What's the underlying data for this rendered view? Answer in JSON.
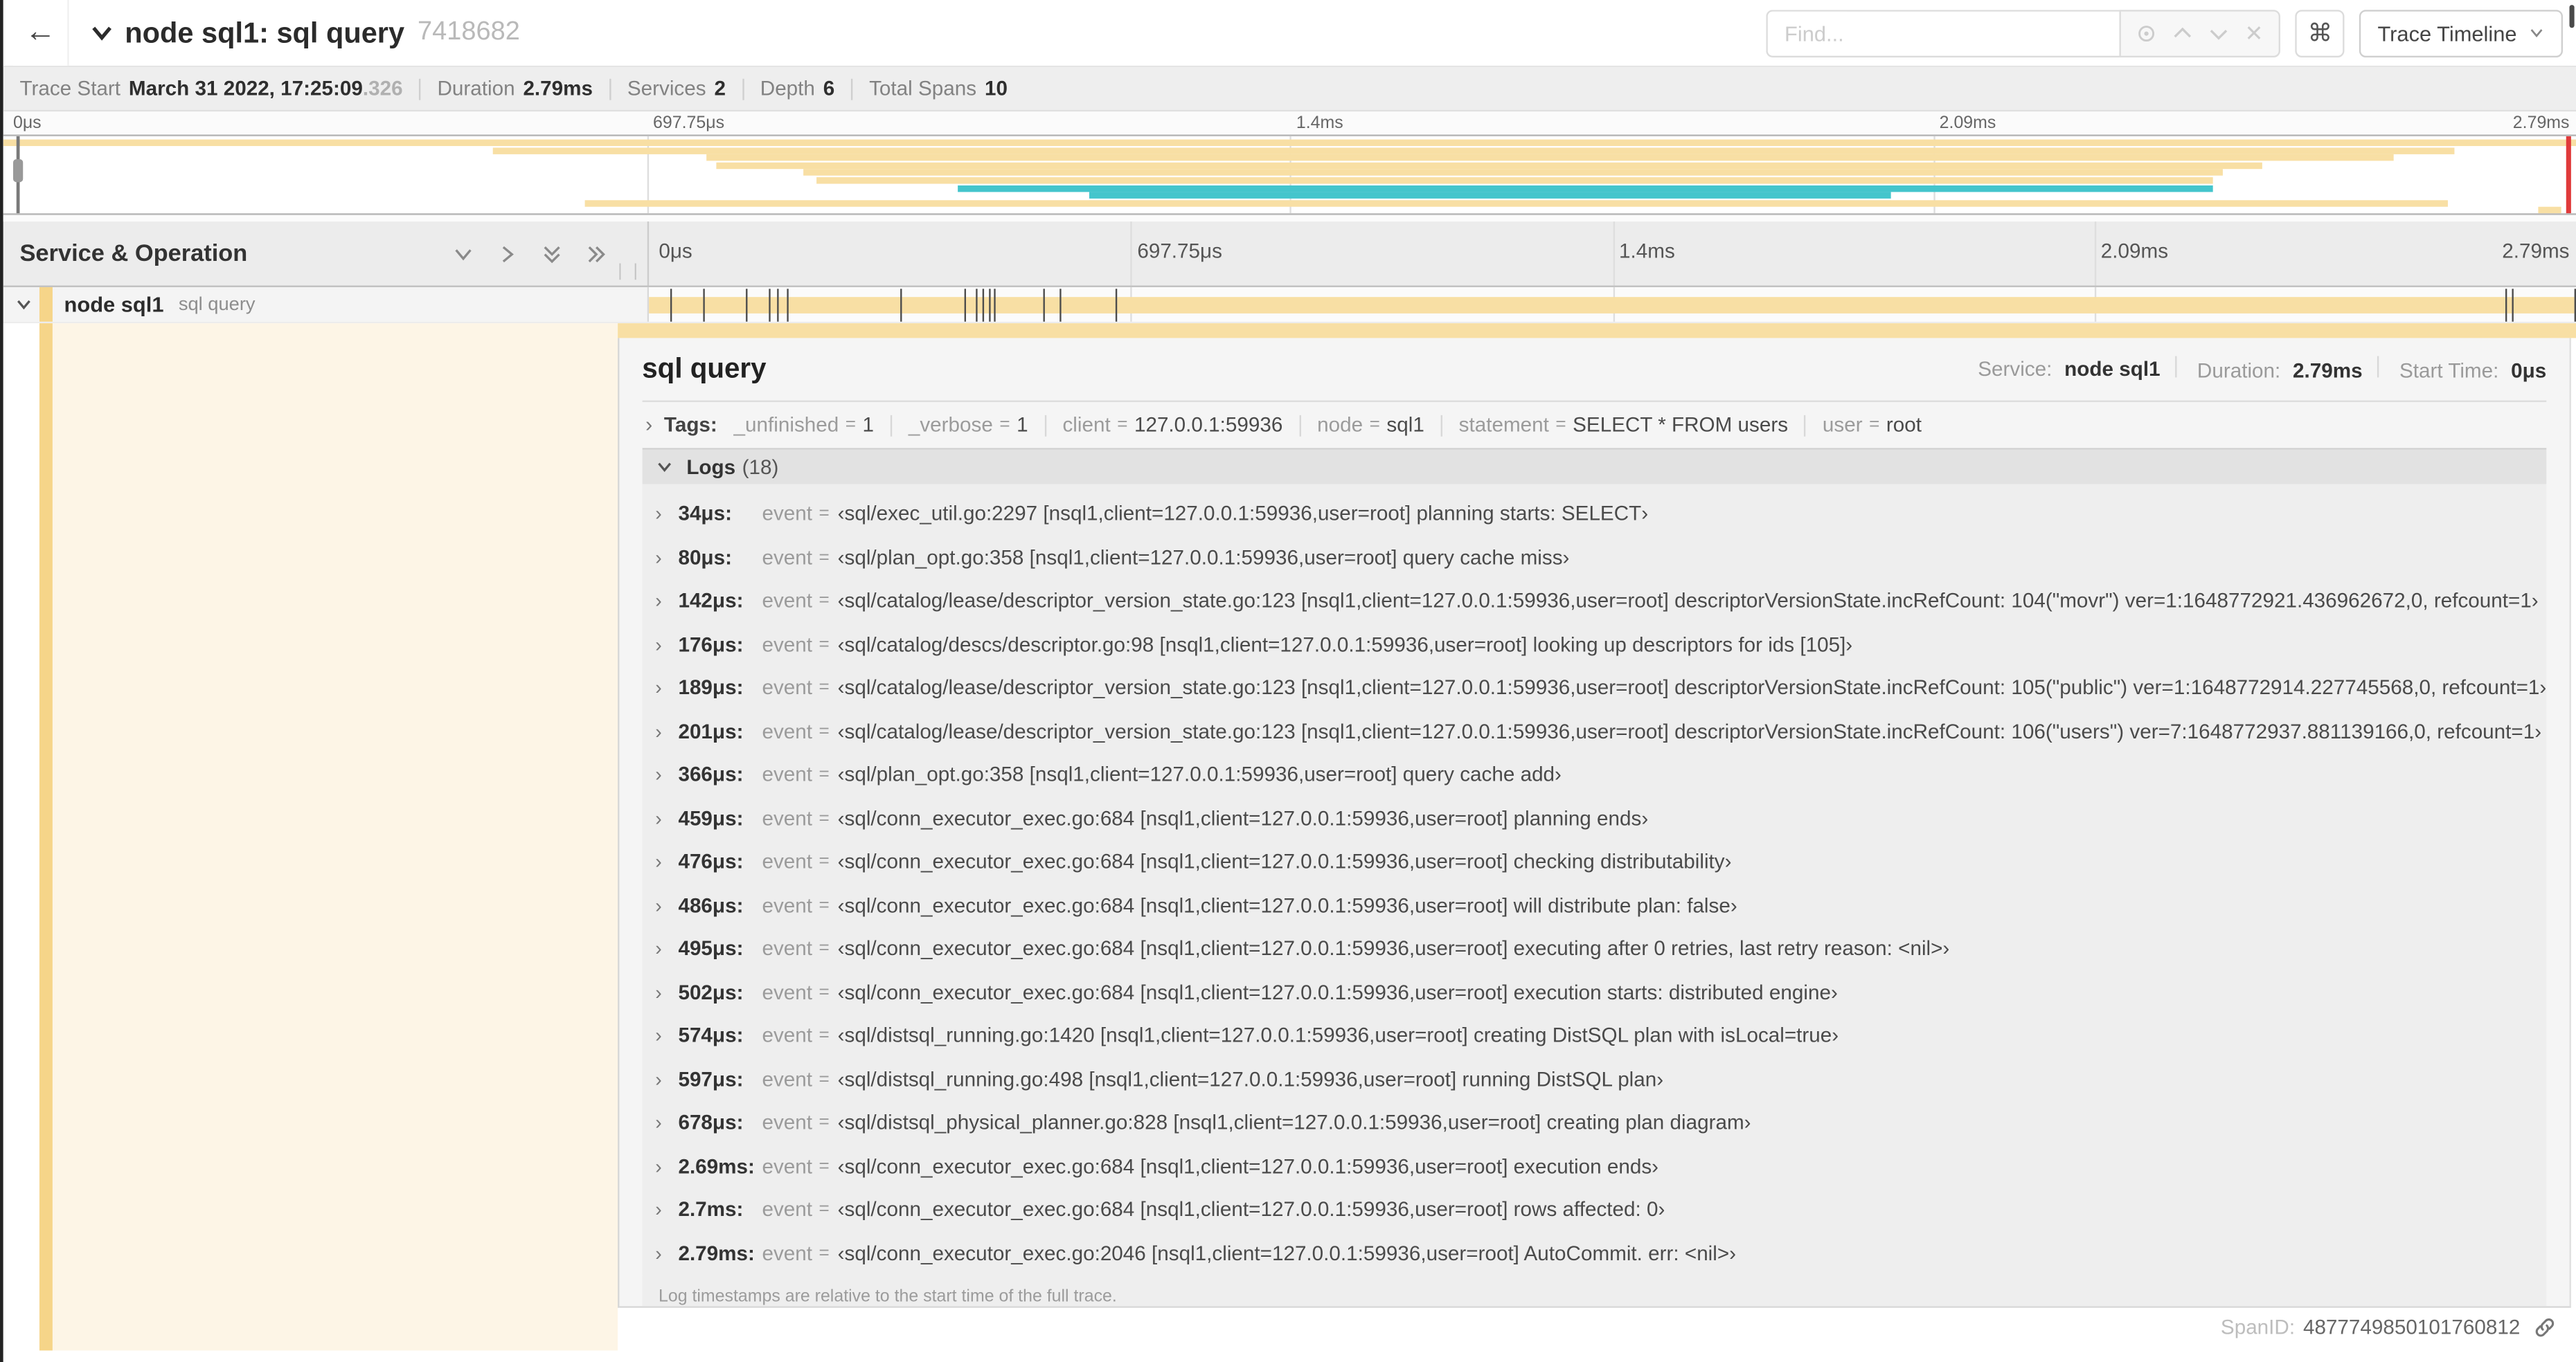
{
  "colors": {
    "tan": "#f8dfa4",
    "teal": "#44c5cc",
    "indent": "#f6d589",
    "cream": "#fdf5e6"
  },
  "trace": {
    "duration_us": 2790
  },
  "header": {
    "back_icon": "←",
    "title": "node sql1: sql query",
    "trace_id": "7418682",
    "find_placeholder": "Find...",
    "shortcut_label": "⌘",
    "view_selector_label": "Trace Timeline"
  },
  "summary": {
    "items": [
      {
        "label": "Trace Start",
        "value": "March 31 2022, 17:25:09",
        "suffix": ".326"
      },
      {
        "label": "Duration",
        "value": "2.79ms",
        "suffix": ""
      },
      {
        "label": "Services",
        "value": "2",
        "suffix": ""
      },
      {
        "label": "Depth",
        "value": "6",
        "suffix": ""
      },
      {
        "label": "Total Spans",
        "value": "10",
        "suffix": ""
      }
    ]
  },
  "timeline": {
    "ticks": [
      {
        "label": "0μs",
        "pct": 0
      },
      {
        "label": "697.75μs",
        "pct": 25
      },
      {
        "label": "1.4ms",
        "pct": 50
      },
      {
        "label": "2.09ms",
        "pct": 75
      },
      {
        "label": "2.79ms",
        "pct": 100
      }
    ]
  },
  "minimap": {
    "spans": [
      {
        "start": 0,
        "end": 100,
        "color": "tan"
      },
      {
        "start": 19,
        "end": 95.3,
        "color": "tan"
      },
      {
        "start": 27.3,
        "end": 92.9,
        "color": "tan"
      },
      {
        "start": 27.7,
        "end": 87.8,
        "color": "tan"
      },
      {
        "start": 31.1,
        "end": 86.3,
        "color": "tan"
      },
      {
        "start": 31.6,
        "end": 85.9,
        "color": "tan"
      },
      {
        "start": 37.1,
        "end": 85.9,
        "color": "teal"
      },
      {
        "start": 42.2,
        "end": 73.4,
        "color": "teal"
      },
      {
        "start": 22.6,
        "end": 95.0,
        "color": "tan"
      },
      {
        "start": 98.5,
        "end": 99.4,
        "color": "tan"
      }
    ]
  },
  "span_list": {
    "header": "Service & Operation",
    "row": {
      "service": "node sql1",
      "operation": "sql query"
    }
  },
  "detail": {
    "title": "sql query",
    "meta": [
      {
        "label": "Service:",
        "value": "node sql1"
      },
      {
        "label": "Duration:",
        "value": "2.79ms"
      },
      {
        "label": "Start Time:",
        "value": "0μs"
      }
    ],
    "tags_label": "Tags:",
    "tags": [
      {
        "key": "_unfinished",
        "value": "1"
      },
      {
        "key": "_verbose",
        "value": "1"
      },
      {
        "key": "client",
        "value": "127.0.0.1:59936"
      },
      {
        "key": "node",
        "value": "sql1"
      },
      {
        "key": "statement",
        "value": "SELECT * FROM users"
      },
      {
        "key": "user",
        "value": "root"
      }
    ],
    "logs_label": "Logs",
    "logs_count": "(18)",
    "event_key": "event",
    "logs": [
      {
        "time": "34μs:",
        "time_us": 34,
        "value": "‹sql/exec_util.go:2297 [nsql1,client=127.0.0.1:59936,user=root] planning starts: SELECT›"
      },
      {
        "time": "80μs:",
        "time_us": 80,
        "value": "‹sql/plan_opt.go:358 [nsql1,client=127.0.0.1:59936,user=root] query cache miss›"
      },
      {
        "time": "142μs:",
        "time_us": 142,
        "value": "‹sql/catalog/lease/descriptor_version_state.go:123 [nsql1,client=127.0.0.1:59936,user=root] descriptorVersionState.incRefCount: 104(\"movr\") ver=1:1648772921.436962672,0, refcount=1›"
      },
      {
        "time": "176μs:",
        "time_us": 176,
        "value": "‹sql/catalog/descs/descriptor.go:98 [nsql1,client=127.0.0.1:59936,user=root] looking up descriptors for ids [105]›"
      },
      {
        "time": "189μs:",
        "time_us": 189,
        "value": "‹sql/catalog/lease/descriptor_version_state.go:123 [nsql1,client=127.0.0.1:59936,user=root] descriptorVersionState.incRefCount: 105(\"public\") ver=1:1648772914.227745568,0, refcount=1›"
      },
      {
        "time": "201μs:",
        "time_us": 201,
        "value": "‹sql/catalog/lease/descriptor_version_state.go:123 [nsql1,client=127.0.0.1:59936,user=root] descriptorVersionState.incRefCount: 106(\"users\") ver=7:1648772937.881139166,0, refcount=1›"
      },
      {
        "time": "366μs:",
        "time_us": 366,
        "value": "‹sql/plan_opt.go:358 [nsql1,client=127.0.0.1:59936,user=root] query cache add›"
      },
      {
        "time": "459μs:",
        "time_us": 459,
        "value": "‹sql/conn_executor_exec.go:684 [nsql1,client=127.0.0.1:59936,user=root] planning ends›"
      },
      {
        "time": "476μs:",
        "time_us": 476,
        "value": "‹sql/conn_executor_exec.go:684 [nsql1,client=127.0.0.1:59936,user=root] checking distributability›"
      },
      {
        "time": "486μs:",
        "time_us": 486,
        "value": "‹sql/conn_executor_exec.go:684 [nsql1,client=127.0.0.1:59936,user=root] will distribute plan: false›"
      },
      {
        "time": "495μs:",
        "time_us": 495,
        "value": "‹sql/conn_executor_exec.go:684 [nsql1,client=127.0.0.1:59936,user=root] executing after 0 retries, last retry reason: <nil>›"
      },
      {
        "time": "502μs:",
        "time_us": 502,
        "value": "‹sql/conn_executor_exec.go:684 [nsql1,client=127.0.0.1:59936,user=root] execution starts: distributed engine›"
      },
      {
        "time": "574μs:",
        "time_us": 574,
        "value": "‹sql/distsql_running.go:1420 [nsql1,client=127.0.0.1:59936,user=root] creating DistSQL plan with isLocal=true›"
      },
      {
        "time": "597μs:",
        "time_us": 597,
        "value": "‹sql/distsql_running.go:498 [nsql1,client=127.0.0.1:59936,user=root] running DistSQL plan›"
      },
      {
        "time": "678μs:",
        "time_us": 678,
        "value": "‹sql/distsql_physical_planner.go:828 [nsql1,client=127.0.0.1:59936,user=root] creating plan diagram›"
      },
      {
        "time": "2.69ms:",
        "time_us": 2690,
        "value": "‹sql/conn_executor_exec.go:684 [nsql1,client=127.0.0.1:59936,user=root] execution ends›"
      },
      {
        "time": "2.7ms:",
        "time_us": 2700,
        "value": "‹sql/conn_executor_exec.go:684 [nsql1,client=127.0.0.1:59936,user=root] rows affected: 0›"
      },
      {
        "time": "2.79ms:",
        "time_us": 2790,
        "value": "‹sql/conn_executor_exec.go:2046 [nsql1,client=127.0.0.1:59936,user=root] AutoCommit. err: <nil>›"
      }
    ],
    "logs_note": "Log timestamps are relative to the start time of the full trace.",
    "footer": {
      "label": "SpanID:",
      "value": "4877749850101760812"
    }
  }
}
